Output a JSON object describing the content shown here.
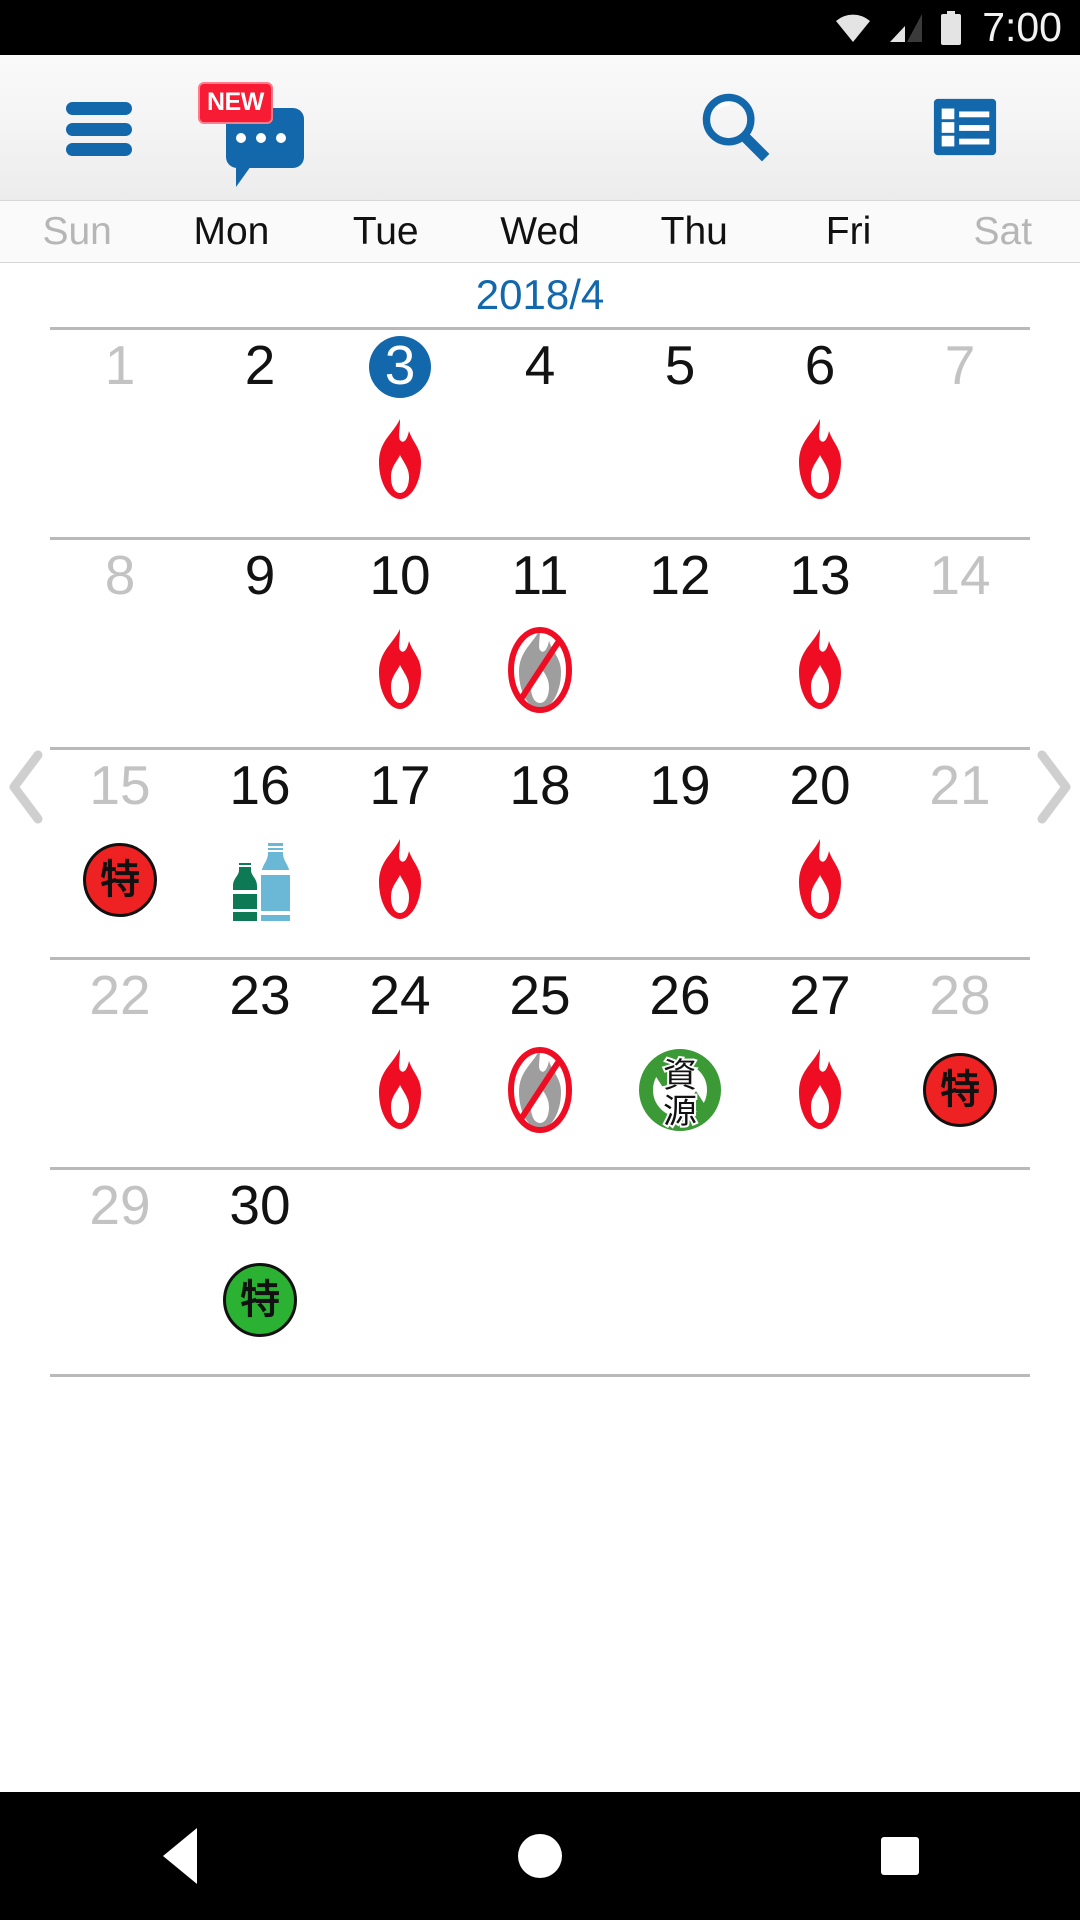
{
  "statusbar": {
    "time": "7:00",
    "icons": [
      "wifi-icon",
      "cellular-signal-icon",
      "battery-icon"
    ]
  },
  "toolbar": {
    "menu_icon": "hamburger-menu-icon",
    "chat_icon": "chat-bubble-icon",
    "chat_badge": "NEW",
    "search_icon": "search-icon",
    "list_icon": "list-view-icon"
  },
  "weekdays": [
    {
      "label": "Sun",
      "dim": true
    },
    {
      "label": "Mon",
      "dim": false
    },
    {
      "label": "Tue",
      "dim": false
    },
    {
      "label": "Wed",
      "dim": false
    },
    {
      "label": "Thu",
      "dim": false
    },
    {
      "label": "Fri",
      "dim": false
    },
    {
      "label": "Sat",
      "dim": true
    }
  ],
  "month_label": "2018/4",
  "nav": {
    "prev_icon": "chevron-left-icon",
    "next_icon": "chevron-right-icon"
  },
  "calendar": {
    "weeks": [
      [
        {
          "day": "1",
          "dim": true,
          "selected": false,
          "icon": null
        },
        {
          "day": "2",
          "dim": false,
          "selected": false,
          "icon": null
        },
        {
          "day": "3",
          "dim": false,
          "selected": true,
          "icon": "flame"
        },
        {
          "day": "4",
          "dim": false,
          "selected": false,
          "icon": null
        },
        {
          "day": "5",
          "dim": false,
          "selected": false,
          "icon": null
        },
        {
          "day": "6",
          "dim": false,
          "selected": false,
          "icon": "flame"
        },
        {
          "day": "7",
          "dim": true,
          "selected": false,
          "icon": null
        }
      ],
      [
        {
          "day": "8",
          "dim": true,
          "selected": false,
          "icon": null
        },
        {
          "day": "9",
          "dim": false,
          "selected": false,
          "icon": null
        },
        {
          "day": "10",
          "dim": false,
          "selected": false,
          "icon": "flame"
        },
        {
          "day": "11",
          "dim": false,
          "selected": false,
          "icon": "no-flame"
        },
        {
          "day": "12",
          "dim": false,
          "selected": false,
          "icon": null
        },
        {
          "day": "13",
          "dim": false,
          "selected": false,
          "icon": "flame"
        },
        {
          "day": "14",
          "dim": true,
          "selected": false,
          "icon": null
        }
      ],
      [
        {
          "day": "15",
          "dim": true,
          "selected": false,
          "icon": "toku-red"
        },
        {
          "day": "16",
          "dim": false,
          "selected": false,
          "icon": "bottles"
        },
        {
          "day": "17",
          "dim": false,
          "selected": false,
          "icon": "flame"
        },
        {
          "day": "18",
          "dim": false,
          "selected": false,
          "icon": null
        },
        {
          "day": "19",
          "dim": false,
          "selected": false,
          "icon": null
        },
        {
          "day": "20",
          "dim": false,
          "selected": false,
          "icon": "flame"
        },
        {
          "day": "21",
          "dim": true,
          "selected": false,
          "icon": null
        }
      ],
      [
        {
          "day": "22",
          "dim": true,
          "selected": false,
          "icon": null
        },
        {
          "day": "23",
          "dim": false,
          "selected": false,
          "icon": null
        },
        {
          "day": "24",
          "dim": false,
          "selected": false,
          "icon": "flame"
        },
        {
          "day": "25",
          "dim": false,
          "selected": false,
          "icon": "no-flame"
        },
        {
          "day": "26",
          "dim": false,
          "selected": false,
          "icon": "recycle"
        },
        {
          "day": "27",
          "dim": false,
          "selected": false,
          "icon": "flame"
        },
        {
          "day": "28",
          "dim": true,
          "selected": false,
          "icon": "toku-red"
        }
      ],
      [
        {
          "day": "29",
          "dim": true,
          "selected": false,
          "icon": null
        },
        {
          "day": "30",
          "dim": false,
          "selected": false,
          "icon": "toku-green"
        },
        {
          "day": "",
          "dim": false,
          "selected": false,
          "icon": null
        },
        {
          "day": "",
          "dim": false,
          "selected": false,
          "icon": null
        },
        {
          "day": "",
          "dim": false,
          "selected": false,
          "icon": null
        },
        {
          "day": "",
          "dim": false,
          "selected": false,
          "icon": null
        },
        {
          "day": "",
          "dim": false,
          "selected": false,
          "icon": null
        }
      ]
    ]
  },
  "icon_labels": {
    "toku": "特",
    "recycle": "資源"
  },
  "colors": {
    "accent_blue": "#1368ac",
    "flame_red": "#ee0d22",
    "toku_red": "#ee2222",
    "toku_green": "#2bb233",
    "recycle_green": "#3c9a36",
    "bottle_green": "#0d7a55",
    "bottle_blue": "#6ab8d6",
    "badge_red": "#f71b33",
    "dim_gray": "#c3c3c3"
  },
  "bottom_nav": {
    "back": "back-icon",
    "home": "home-icon",
    "recents": "recents-icon"
  }
}
